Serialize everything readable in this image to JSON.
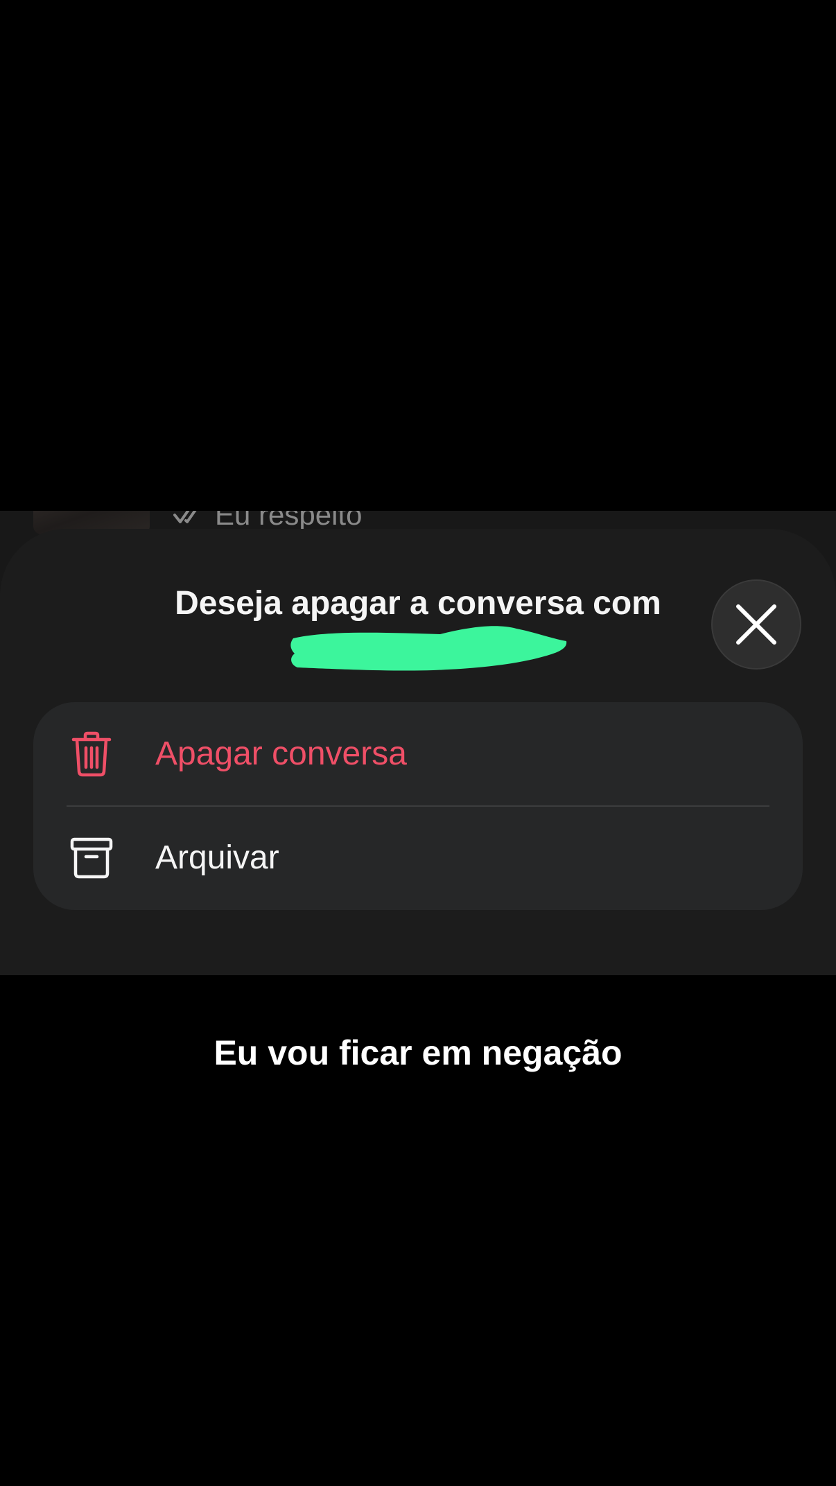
{
  "background_chat": {
    "last_message_preview": "Eu respeito",
    "status_icon": "double-check-icon"
  },
  "sheet": {
    "title": "Deseja apagar a conversa com",
    "close_icon": "close-icon",
    "options": [
      {
        "label": "Apagar conversa",
        "icon": "trash-icon",
        "color": "#ef4f67"
      },
      {
        "label": "Arquivar",
        "icon": "archive-box-icon",
        "color": "#f5f5f5"
      }
    ]
  },
  "colors": {
    "sheet_background": "#1c1c1c",
    "card_background": "#262728",
    "danger": "#ef4f67",
    "redaction": "#3cf59c"
  },
  "caption": "Eu vou ficar em negação"
}
